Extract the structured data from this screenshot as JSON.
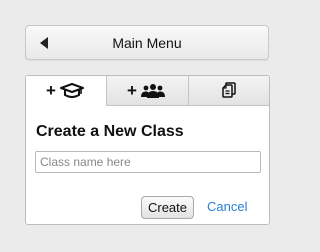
{
  "main_menu": {
    "label": "Main Menu",
    "back_icon": "back-arrow-icon"
  },
  "tabs": [
    {
      "name": "add-class",
      "plus": "+",
      "icon": "graduation-cap-icon",
      "active": true
    },
    {
      "name": "add-group",
      "plus": "+",
      "icon": "group-icon",
      "active": false
    },
    {
      "name": "copy",
      "icon": "copy-icon",
      "active": false
    }
  ],
  "form": {
    "title": "Create a New Class",
    "input_value": "",
    "input_placeholder": "Class name here",
    "create_label": "Create",
    "cancel_label": "Cancel"
  },
  "colors": {
    "background": "#ebebeb",
    "link": "#2a7fd5"
  }
}
